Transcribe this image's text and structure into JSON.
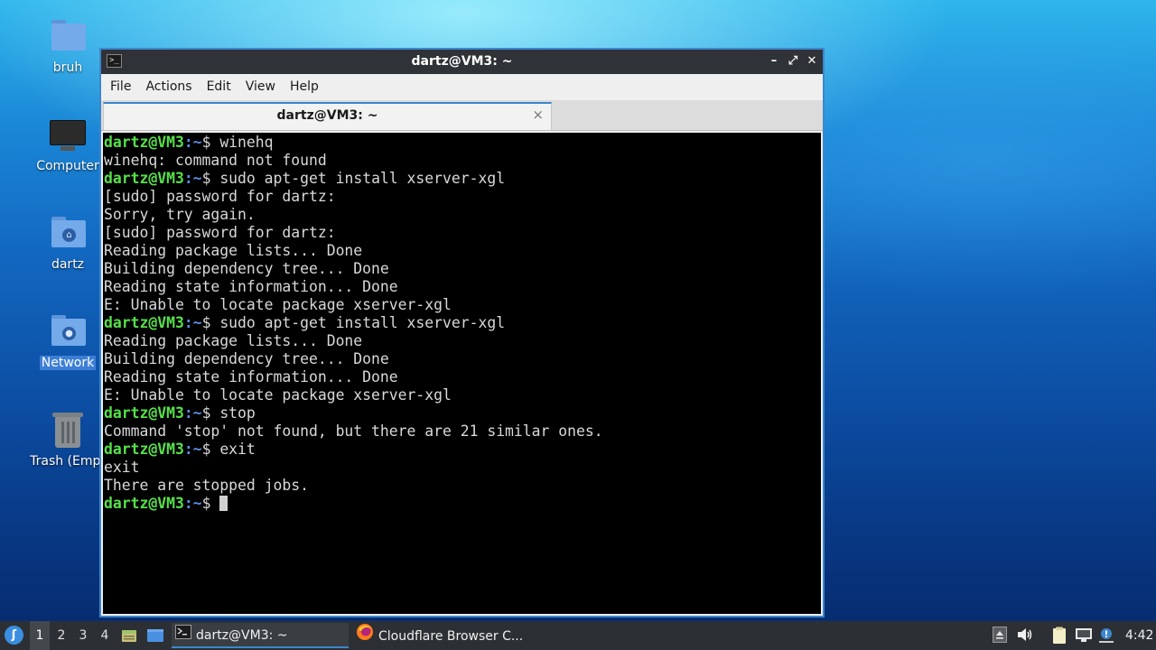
{
  "desktop": {
    "icons": [
      {
        "label": "bruh",
        "icon": "folder-icon"
      },
      {
        "label": "Computer",
        "icon": "computer-icon"
      },
      {
        "label": "dartz",
        "icon": "home-folder-icon"
      },
      {
        "label": "Network",
        "icon": "network-folder-icon",
        "selected": true
      },
      {
        "label": "Trash (Empt",
        "icon": "trash-icon"
      }
    ]
  },
  "window": {
    "title": "dartz@VM3: ~",
    "menu": [
      "File",
      "Actions",
      "Edit",
      "View",
      "Help"
    ],
    "tab_label": "dartz@VM3: ~",
    "tab_close": "×",
    "controls": {
      "minimize": "–",
      "maximize": "⤢",
      "close": "✕"
    }
  },
  "terminal": {
    "prompt_user": "dartz@VM3",
    "prompt_path": ":~",
    "prompt_symbol": "$ ",
    "lines": [
      {
        "type": "cmd",
        "text": "winehq"
      },
      {
        "type": "out",
        "text": "winehq: command not found"
      },
      {
        "type": "cmd",
        "text": "sudo apt-get install xserver-xgl"
      },
      {
        "type": "out",
        "text": "[sudo] password for dartz:"
      },
      {
        "type": "out",
        "text": "Sorry, try again."
      },
      {
        "type": "out",
        "text": "[sudo] password for dartz:"
      },
      {
        "type": "out",
        "text": "Reading package lists... Done"
      },
      {
        "type": "out",
        "text": "Building dependency tree... Done"
      },
      {
        "type": "out",
        "text": "Reading state information... Done"
      },
      {
        "type": "out",
        "text": "E: Unable to locate package xserver-xgl"
      },
      {
        "type": "cmd",
        "text": "sudo apt-get install xserver-xgl"
      },
      {
        "type": "out",
        "text": "Reading package lists... Done"
      },
      {
        "type": "out",
        "text": "Building dependency tree... Done"
      },
      {
        "type": "out",
        "text": "Reading state information... Done"
      },
      {
        "type": "out",
        "text": "E: Unable to locate package xserver-xgl"
      },
      {
        "type": "cmd",
        "text": "stop"
      },
      {
        "type": "out",
        "text": "Command 'stop' not found, but there are 21 similar ones."
      },
      {
        "type": "cmd",
        "text": "exit"
      },
      {
        "type": "out",
        "text": "exit"
      },
      {
        "type": "out",
        "text": "There are stopped jobs."
      },
      {
        "type": "cmd",
        "text": "",
        "cursor": true
      }
    ]
  },
  "taskbar": {
    "workspaces": [
      "1",
      "2",
      "3",
      "4"
    ],
    "active_workspace": "1",
    "tasks": [
      {
        "label": "dartz@VM3: ~",
        "icon": "terminal-icon",
        "active": true
      },
      {
        "label": "Cloudflare Browser C...",
        "icon": "firefox-icon",
        "active": false
      }
    ],
    "clock": "4:42"
  },
  "colors": {
    "prompt_user": "#56e04a",
    "prompt_path": "#5c8ee6",
    "terminal_bg": "#000000",
    "accent": "#3d86cc"
  }
}
